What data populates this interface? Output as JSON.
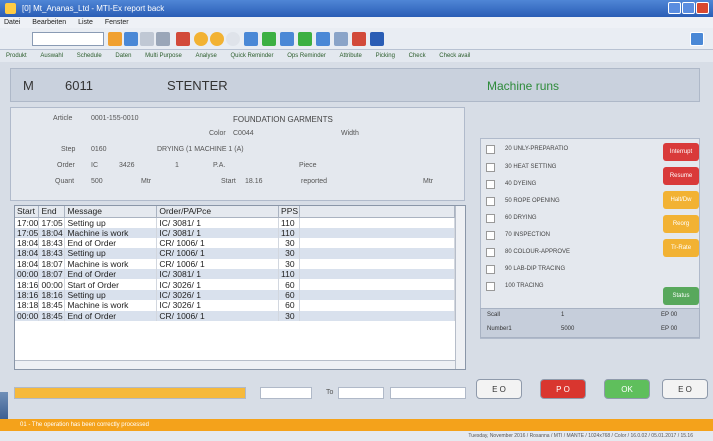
{
  "window": {
    "title": "[0] Mt_Ananas_Ltd - MTI-Ex report back"
  },
  "menu": [
    "Datei",
    "Bearbeiten",
    "Liste",
    "Fenster"
  ],
  "tabs": [
    "Produkt",
    "Auswahl",
    "Schedule",
    "Daten",
    "Multi Purpose",
    "Analyse",
    "Quick Reminder",
    "Ops Reminder",
    "Attribute",
    "Picking",
    "Check",
    "Check avail"
  ],
  "header": {
    "prefix": "M",
    "number": "6011",
    "machine": "STENTER",
    "status": "Machine runs"
  },
  "order_info": {
    "article_label": "Article",
    "article_value": "0001-155-0010",
    "description": "FOUNDATION GARMENTS",
    "color_label": "Color",
    "color_value": "C0044",
    "width_label": "Width",
    "step_label": "Step",
    "step_value": "0160",
    "step_text": "DRYING (1 MACHINE 1 (A)",
    "order_label": "Order",
    "order_value": "IC",
    "order_num": "3426",
    "order_seq": "1",
    "pa_label": "P.A.",
    "piece_label": "Piece",
    "quant_label": "Quant",
    "quant_value": "500",
    "quant_unit": "Mtr",
    "start_label": "Start",
    "start_value": "18.16",
    "reported": "reported",
    "unit_right": "Mtr"
  },
  "table": {
    "columns": [
      "Start",
      "End",
      "Message",
      "Order/PA/Pce",
      "PPS"
    ],
    "rows": [
      {
        "start": "17:00",
        "end": "17:05",
        "message": "Setting up",
        "order": "IC/ 3081/ 1",
        "pps": "110"
      },
      {
        "start": "17:05",
        "end": "18:04",
        "message": "Machine is work",
        "order": "IC/ 3081/ 1",
        "pps": "110"
      },
      {
        "start": "18:04",
        "end": "18:43",
        "message": "End of Order",
        "order": "CR/ 1006/ 1",
        "pps": "30"
      },
      {
        "start": "18:04",
        "end": "18:43",
        "message": "Setting up",
        "order": "CR/ 1006/ 1",
        "pps": "30"
      },
      {
        "start": "18:04",
        "end": "18:07",
        "message": "Machine is work",
        "order": "CR/ 1006/ 1",
        "pps": "30"
      },
      {
        "start": "00:00",
        "end": "18:07",
        "message": "End of Order",
        "order": "IC/ 3081/ 1",
        "pps": "110"
      },
      {
        "start": "18:16",
        "end": "00:00",
        "message": "Start of Order",
        "order": "IC/ 3026/ 1",
        "pps": "60"
      },
      {
        "start": "18:16",
        "end": "18:16",
        "message": "Setting up",
        "order": "IC/ 3026/ 1",
        "pps": "60"
      },
      {
        "start": "18:18",
        "end": "18:45",
        "message": "Machine is work",
        "order": "IC/ 3026/ 1",
        "pps": "60"
      },
      {
        "start": "00:00",
        "end": "18:45",
        "message": "End of Order",
        "order": "CR/ 1006/ 1",
        "pps": "30"
      }
    ]
  },
  "steps": [
    {
      "label": "20 UNLY-PREPARATIO"
    },
    {
      "label": "30 HEAT SETTING"
    },
    {
      "label": "40 DYEING"
    },
    {
      "label": "50 ROPE OPENING"
    },
    {
      "label": "60 DRYING"
    },
    {
      "label": "70 INSPECTION"
    },
    {
      "label": "80 COLOUR-APPROVE"
    },
    {
      "label": "90 LAB-DIP TRACING"
    },
    {
      "label": "100 TRACING"
    }
  ],
  "side_buttons": [
    {
      "label": "Interrupt",
      "color": "#d93a3a"
    },
    {
      "label": "Resume",
      "color": "#d93a3a"
    },
    {
      "label": "Halt/Dw",
      "color": "#f2b233"
    },
    {
      "label": "Reorg",
      "color": "#f2b233"
    },
    {
      "label": "Tr-Rate",
      "color": "#f2b233"
    },
    {
      "label": "Status",
      "color": "#58a85c"
    }
  ],
  "mini_table": {
    "r1": [
      "Scall",
      "1",
      "EP 00"
    ],
    "r2": [
      "Number1",
      "5000",
      "EP 00"
    ]
  },
  "progress": {
    "value_pct": 100,
    "to_label": "To"
  },
  "bottom_buttons": [
    {
      "label": "E O",
      "color": "#f3f3f3",
      "text": "#333"
    },
    {
      "label": "P O",
      "color": "#d9362f",
      "text": "#fff"
    },
    {
      "label": "OK",
      "color": "#5fbf5c",
      "text": "#fff"
    },
    {
      "label": "E O",
      "color": "#f3f3f3",
      "text": "#333"
    }
  ],
  "statusbar": {
    "text": "01 - The operation has been correctly processed"
  },
  "footer": {
    "text": "Tuesday, November 2016 / Rosanna / MTI / MANTE / 1024x768 / Color / 16.0.02 / 05.01.2017 / 15.16"
  }
}
